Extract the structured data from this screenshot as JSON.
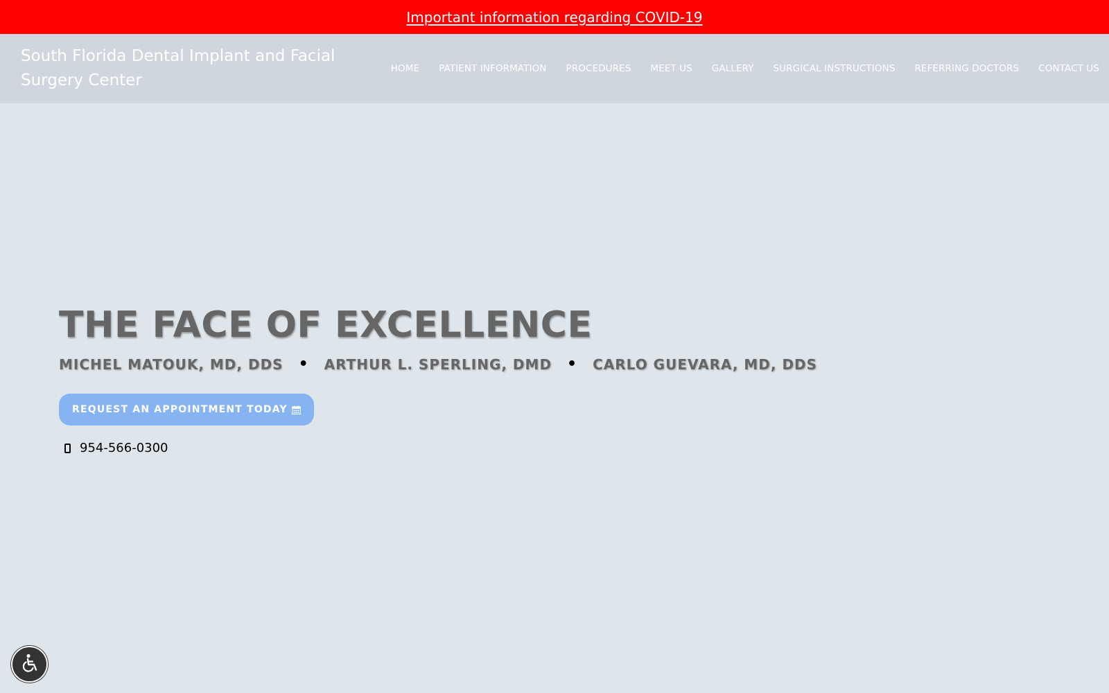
{
  "banner": {
    "link_text": "Important information regarding COVID-19",
    "background_color": "#ff0000"
  },
  "header": {
    "site_title": "South Florida Dental Implant and Facial Surgery Center",
    "nav": [
      {
        "label": "HOME"
      },
      {
        "label": "PATIENT INFORMATION"
      },
      {
        "label": "PROCEDURES"
      },
      {
        "label": "MEET US"
      },
      {
        "label": "GALLERY"
      },
      {
        "label": "SURGICAL INSTRUCTIONS"
      },
      {
        "label": "REFERRING DOCTORS"
      },
      {
        "label": "CONTACT US"
      }
    ]
  },
  "hero": {
    "title": "THE FACE OF EXCELLENCE",
    "doctors": [
      "MICHEL MATOUK, MD, DDS",
      "ARTHUR L. SPERLING, DMD",
      "CARLO GUEVARA, MD, DDS"
    ],
    "separator": "•",
    "cta_label": "REQUEST AN APPOINTMENT TODAY",
    "cta_icon": "calendar-icon",
    "cta_color": "#86b4f3",
    "phone": "954-566-0300",
    "phone_icon": "mobile-phone-icon"
  },
  "accessibility": {
    "icon": "wheelchair-icon"
  }
}
